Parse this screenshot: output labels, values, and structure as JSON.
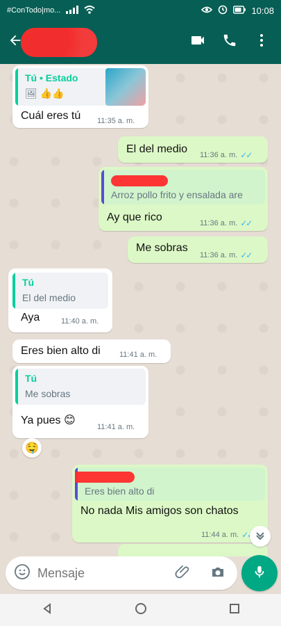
{
  "status_bar": {
    "carrier_text": "#ConTodo|mo...",
    "time": "10:08"
  },
  "header": {
    "icons": [
      "back-arrow-icon",
      "video-call-icon",
      "phone-call-icon",
      "more-vert-icon"
    ]
  },
  "messages": {
    "m1": {
      "quote_title": "Tú • Estado",
      "quote_emojis": "🖼 👍👍",
      "text": "Cuál eres tú",
      "time": "11:35 a. m."
    },
    "m2": {
      "text": "El del medio",
      "time": "11:36 a. m."
    },
    "m3": {
      "quote_text": "Arroz pollo frito y ensalada are",
      "text": "Ay que rico",
      "time": "11:36 a. m."
    },
    "m4": {
      "text": "Me sobras",
      "time": "11:36 a. m."
    },
    "m5": {
      "quote_title": "Tú",
      "quote_text": "El del medio",
      "text": "Aya",
      "time": "11:40 a. m."
    },
    "m6": {
      "text": "Eres bien alto di",
      "time": "11:41 a. m."
    },
    "m7": {
      "quote_title": "Tú",
      "quote_text": "Me sobras",
      "text": "Ya pues 😊",
      "time": "11:41 a. m.",
      "reaction": "🤤"
    },
    "m8": {
      "quote_text": "Eres bien alto di",
      "text": "No nada Mis amigos son chatos",
      "time": "11:44 a. m."
    }
  },
  "composer": {
    "placeholder": "Mensaje"
  }
}
